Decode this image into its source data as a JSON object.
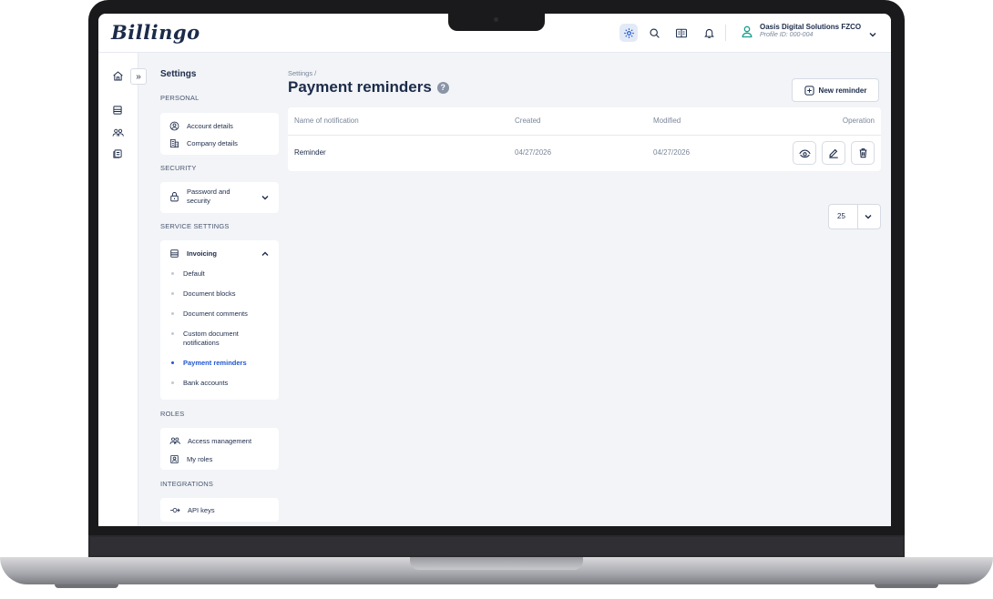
{
  "app": {
    "logo": "Billingo"
  },
  "header": {
    "company_name": "Oasis Digital Solutions FZCO",
    "profile_id": "Profile ID: 000-004",
    "icons": [
      "gear-icon",
      "search-icon",
      "book-icon",
      "bell-icon"
    ]
  },
  "rail": {
    "toggle": "»",
    "icons": [
      "home-icon",
      "invoice-icon",
      "users-icon",
      "documents-icon"
    ]
  },
  "settings_nav": {
    "title": "Settings",
    "personal": {
      "label": "PERSONAL",
      "items": [
        "Account details",
        "Company details"
      ]
    },
    "security": {
      "label": "SECURITY",
      "item": "Password and security"
    },
    "service": {
      "label": "SERVICE SETTINGS",
      "group": "Invoicing",
      "subitems": [
        "Default",
        "Document blocks",
        "Document comments",
        "Custom document notifications",
        "Payment reminders",
        "Bank accounts"
      ],
      "active": "Payment reminders"
    },
    "roles": {
      "label": "ROLES",
      "items": [
        "Access management",
        "My roles"
      ]
    },
    "integrations": {
      "label": "INTEGRATIONS",
      "items": [
        "API keys"
      ]
    }
  },
  "main": {
    "breadcrumb": "Settings /",
    "title": "Payment reminders",
    "help": "?",
    "new_button": "New reminder",
    "table": {
      "columns": [
        "Name of notification",
        "Created",
        "Modified",
        "Operation"
      ],
      "rows": [
        {
          "name": "Reminder",
          "created": "04/27/2026",
          "modified": "04/27/2026"
        }
      ]
    },
    "page_size": "25"
  },
  "colors": {
    "primary": "#1c2b4a",
    "accent": "#1f55d0",
    "teal": "#1a9c8c"
  }
}
